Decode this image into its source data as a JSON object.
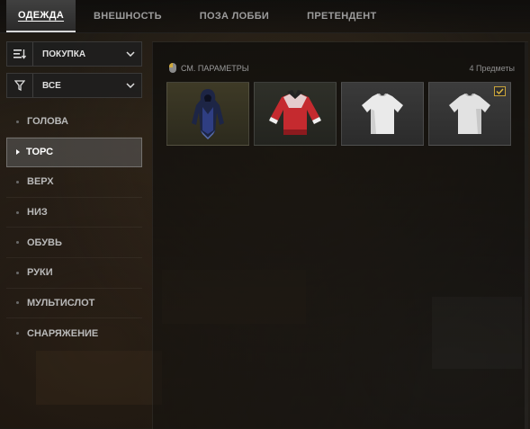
{
  "tabs": [
    {
      "label": "ОДЕЖДА",
      "active": true
    },
    {
      "label": "ВНЕШНОСТЬ",
      "active": false
    },
    {
      "label": "ПОЗА ЛОББИ",
      "active": false
    },
    {
      "label": "ПРЕТЕНДЕНТ",
      "active": false
    }
  ],
  "sort_dropdown": {
    "icon": "sort-icon",
    "value": "ПОКУПКА"
  },
  "filter_dropdown": {
    "icon": "filter-icon",
    "value": "ВСЕ"
  },
  "categories": [
    {
      "label": "ГОЛОВА",
      "active": false
    },
    {
      "label": "ТОРС",
      "active": true
    },
    {
      "label": "ВЕРХ",
      "active": false
    },
    {
      "label": "НИЗ",
      "active": false
    },
    {
      "label": "ОБУВЬ",
      "active": false
    },
    {
      "label": "РУКИ",
      "active": false
    },
    {
      "label": "МУЛЬТИСЛОТ",
      "active": false
    },
    {
      "label": "СНАРЯЖЕНИЕ",
      "active": false
    }
  ],
  "panel": {
    "params_label": "СМ. ПАРАМЕТРЫ",
    "item_count": "4 Предметы"
  },
  "items": [
    {
      "icon": "blue-hooded-outfit-icon",
      "equipped": false
    },
    {
      "icon": "red-jersey-icon",
      "equipped": false
    },
    {
      "icon": "white-tshirt-icon",
      "equipped": false
    },
    {
      "icon": "white-tshirt-icon",
      "equipped": true
    }
  ],
  "colors": {
    "accent_check": "#c9a43a",
    "active_tab_bg": "#4a4a4a"
  }
}
